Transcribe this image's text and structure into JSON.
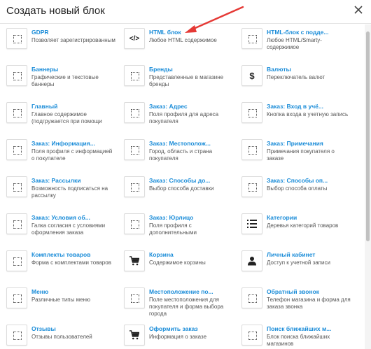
{
  "dialog": {
    "title": "Создать новый блок"
  },
  "colors": {
    "link": "#1a8cd8",
    "arrow": "#e53935"
  },
  "blocks": [
    {
      "name": "GDPR",
      "desc": "Позволяет зарегистрированным",
      "icon": "placeholder-icon"
    },
    {
      "name": "HTML блок",
      "desc": "Любое HTML содержимое",
      "icon": "code-icon"
    },
    {
      "name": "HTML-блок с подде...",
      "desc": "Любое HTML/Smarty-содержимое",
      "icon": "placeholder-icon"
    },
    {
      "name": "Баннеры",
      "desc": "Графические и текстовые баннеры",
      "icon": "placeholder-icon"
    },
    {
      "name": "Бренды",
      "desc": "Представленные в магазине бренды",
      "icon": "placeholder-icon"
    },
    {
      "name": "Валюты",
      "desc": "Переключатель валют",
      "icon": "dollar-icon"
    },
    {
      "name": "Главный",
      "desc": "Главное содержимое (подгружается при помощи",
      "icon": "placeholder-icon"
    },
    {
      "name": "Заказ: Адрес",
      "desc": "Поля профиля для адреса покупателя",
      "icon": "placeholder-icon"
    },
    {
      "name": "Заказ: Вход в учё...",
      "desc": "Кнопка входа в учетную запись",
      "icon": "placeholder-icon"
    },
    {
      "name": "Заказ: Информация...",
      "desc": "Поля профиля с информацией о покупателе",
      "icon": "placeholder-icon"
    },
    {
      "name": "Заказ: Местополож...",
      "desc": "Город, область и страна покупателя",
      "icon": "placeholder-icon"
    },
    {
      "name": "Заказ: Примечания",
      "desc": "Примечания покупателя о заказе",
      "icon": "placeholder-icon"
    },
    {
      "name": "Заказ: Рассылки",
      "desc": "Возможность подписаться на рассылку",
      "icon": "placeholder-icon"
    },
    {
      "name": "Заказ: Способы до...",
      "desc": "Выбор способа доставки",
      "icon": "placeholder-icon"
    },
    {
      "name": "Заказ: Способы оп...",
      "desc": "Выбор способа оплаты",
      "icon": "placeholder-icon"
    },
    {
      "name": "Заказ: Условия об...",
      "desc": "Галка согласия с условиями оформления заказа",
      "icon": "placeholder-icon"
    },
    {
      "name": "Заказ: Юрлицо",
      "desc": "Поля профиля с дополнительными",
      "icon": "placeholder-icon"
    },
    {
      "name": "Категории",
      "desc": "Деревья категорий товаров",
      "icon": "list-icon"
    },
    {
      "name": "Комплекты товаров",
      "desc": "Форма с комплектами товаров",
      "icon": "placeholder-icon"
    },
    {
      "name": "Корзина",
      "desc": "Содержимое корзины",
      "icon": "cart-icon"
    },
    {
      "name": "Личный кабинет",
      "desc": "Доступ к учетной записи",
      "icon": "user-icon"
    },
    {
      "name": "Меню",
      "desc": "Различные типы меню",
      "icon": "placeholder-icon"
    },
    {
      "name": "Местоположение по...",
      "desc": "Поле местоположения для покупателя и форма выбора города",
      "icon": "placeholder-icon"
    },
    {
      "name": "Обратный звонок",
      "desc": "Телефон магазина и форма для заказа звонка",
      "icon": "placeholder-icon"
    },
    {
      "name": "Отзывы",
      "desc": "Отзывы пользователей",
      "icon": "placeholder-icon"
    },
    {
      "name": "Оформить заказ",
      "desc": "Информация о заказе",
      "icon": "cart-icon"
    },
    {
      "name": "Поиск ближайших м...",
      "desc": "Блок поиска ближайших магазинов",
      "icon": "placeholder-icon"
    }
  ]
}
